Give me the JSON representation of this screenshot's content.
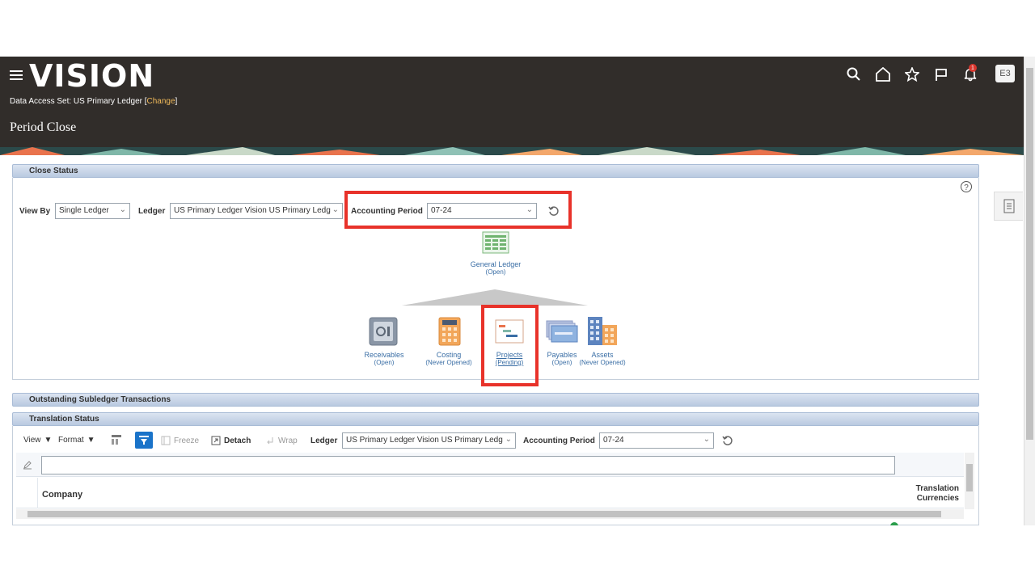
{
  "header": {
    "logo": "VISION",
    "data_access_label": "Data Access Set: US Primary Ledger [",
    "data_access_change": "Change",
    "data_access_close": "]",
    "page_title": "Period Close",
    "avatar": "E3",
    "notification_count": "1",
    "icons": [
      "search-icon",
      "home-icon",
      "star-icon",
      "flag-icon",
      "bell-icon"
    ]
  },
  "close_status": {
    "title": "Close Status",
    "view_by_label": "View By",
    "view_by_value": "Single Ledger",
    "ledger_label": "Ledger",
    "ledger_value": "US Primary Ledger Vision US Primary Ledg",
    "period_label": "Accounting Period",
    "period_value": "07-24",
    "general_ledger": {
      "name": "General Ledger",
      "status": "(Open)"
    },
    "subledgers": [
      {
        "name": "Receivables",
        "status": "(Open)"
      },
      {
        "name": "Costing",
        "status": "(Never Opened)"
      },
      {
        "name": "Projects",
        "status": "(Pending)"
      },
      {
        "name": "Payables",
        "status": "(Open)"
      },
      {
        "name": "Assets",
        "status": "(Never Opened)"
      }
    ]
  },
  "outstanding": {
    "title": "Outstanding Subledger Transactions"
  },
  "translation": {
    "title": "Translation Status",
    "view_label": "View",
    "format_label": "Format",
    "freeze_label": "Freeze",
    "detach_label": "Detach",
    "wrap_label": "Wrap",
    "ledger_label": "Ledger",
    "ledger_value": "US Primary Ledger Vision US Primary Ledg",
    "period_label": "Accounting Period",
    "period_value": "07-24",
    "col_company": "Company",
    "col_translation_1": "Translation",
    "col_translation_2": "Currencies"
  },
  "colors": {
    "header_bg": "#312d2a",
    "highlight": "#e8322a",
    "link": "#3a6ea5"
  }
}
